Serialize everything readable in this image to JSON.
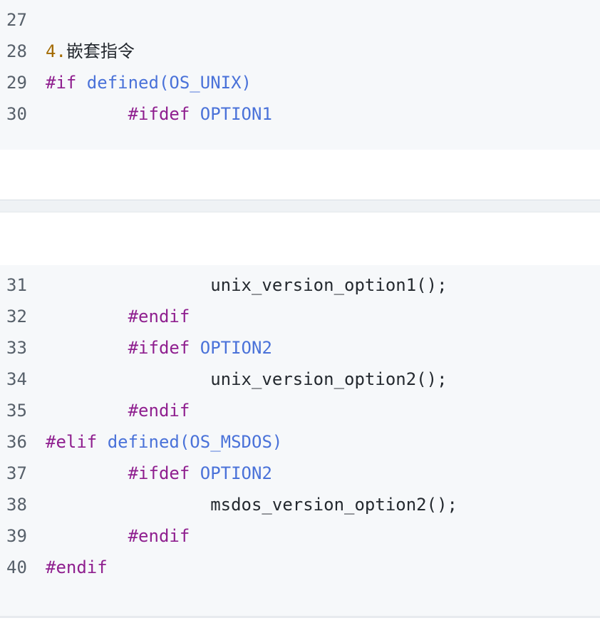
{
  "block1": {
    "lines": [
      {
        "num": "27",
        "parts": []
      },
      {
        "num": "28",
        "parts": [
          {
            "t": "4.",
            "c": "num"
          },
          {
            "t": "嵌套指令",
            "c": "cjk"
          }
        ]
      },
      {
        "num": "29",
        "parts": [
          {
            "t": "#if",
            "c": "kw"
          },
          {
            "t": " defined(OS_UNIX)",
            "c": "fn"
          }
        ]
      },
      {
        "num": "30",
        "parts": [
          {
            "t": "        ",
            "c": "txt"
          },
          {
            "t": "#ifdef",
            "c": "kw"
          },
          {
            "t": " OPTION1",
            "c": "fn"
          }
        ]
      }
    ]
  },
  "block2": {
    "lines": [
      {
        "num": "31",
        "parts": [
          {
            "t": "                unix_version_option1();",
            "c": "txt"
          }
        ]
      },
      {
        "num": "32",
        "parts": [
          {
            "t": "        ",
            "c": "txt"
          },
          {
            "t": "#endif",
            "c": "kw"
          }
        ]
      },
      {
        "num": "33",
        "parts": [
          {
            "t": "        ",
            "c": "txt"
          },
          {
            "t": "#ifdef",
            "c": "kw"
          },
          {
            "t": " OPTION2",
            "c": "fn"
          }
        ]
      },
      {
        "num": "34",
        "parts": [
          {
            "t": "                unix_version_option2();",
            "c": "txt"
          }
        ]
      },
      {
        "num": "35",
        "parts": [
          {
            "t": "        ",
            "c": "txt"
          },
          {
            "t": "#endif",
            "c": "kw"
          }
        ]
      },
      {
        "num": "36",
        "parts": [
          {
            "t": "#elif",
            "c": "kw"
          },
          {
            "t": " defined(OS_MSDOS)",
            "c": "fn"
          }
        ]
      },
      {
        "num": "37",
        "parts": [
          {
            "t": "        ",
            "c": "txt"
          },
          {
            "t": "#ifdef",
            "c": "kw"
          },
          {
            "t": " OPTION2",
            "c": "fn"
          }
        ]
      },
      {
        "num": "38",
        "parts": [
          {
            "t": "                msdos_version_option2();",
            "c": "txt"
          }
        ]
      },
      {
        "num": "39",
        "parts": [
          {
            "t": "        ",
            "c": "txt"
          },
          {
            "t": "#endif",
            "c": "kw"
          }
        ]
      },
      {
        "num": "40",
        "parts": [
          {
            "t": "#endif",
            "c": "kw"
          }
        ]
      }
    ]
  },
  "colors": {
    "code_background": "#f6f8fa",
    "line_number": "#57606a",
    "directive": "#8f1f8f",
    "identifier": "#4a72d9",
    "list_number": "#a36a00",
    "plain_text": "#24292f"
  }
}
